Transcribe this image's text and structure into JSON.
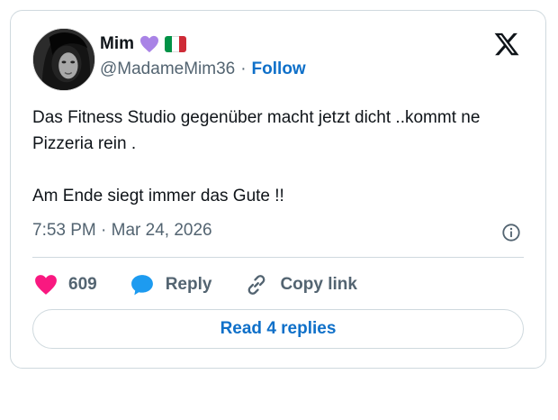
{
  "author": {
    "name": "Mim",
    "handle": "@MadameMim36",
    "separator": "·",
    "follow_label": "Follow",
    "emoji": [
      "purple-heart",
      "italy-flag"
    ]
  },
  "tweet": {
    "paragraphs": [
      "Das Fitness Studio gegenüber macht jetzt dicht ..kommt ne Pizzeria rein .",
      "Am Ende siegt immer das Gute !!"
    ],
    "timestamp": "7:53 PM · Mar 24, 2026"
  },
  "actions": {
    "likes_count": "609",
    "reply_label": "Reply",
    "copy_link_label": "Copy link"
  },
  "read_replies_label": "Read 4 replies",
  "colors": {
    "like_heart": "#f91880",
    "reply_bubble": "#1d9bf0",
    "link_blue": "#0f70c9",
    "secondary_text": "#536471",
    "border": "#cfd9de",
    "purple_heart": "#a983e6",
    "flag": [
      "#009246",
      "#ffffff",
      "#ce2b37"
    ]
  },
  "icons": [
    "x-logo-icon",
    "info-icon",
    "heart-icon",
    "reply-bubble-icon",
    "link-icon"
  ]
}
